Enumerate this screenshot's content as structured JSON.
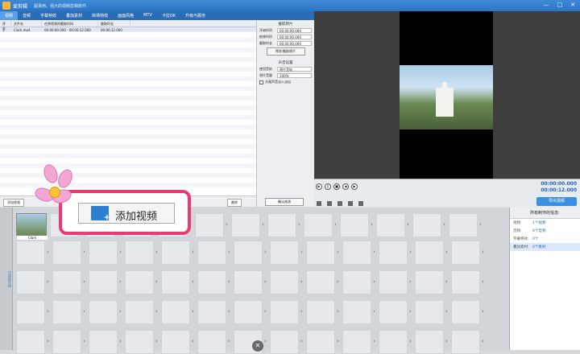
{
  "app": {
    "name": "爱剪辑",
    "slogan": "超易用、强大的视频剪辑软件"
  },
  "tabs": [
    "视频",
    "音频",
    "字幕特效",
    "叠加素材",
    "转场特效",
    "画面风格",
    "MTV",
    "卡拉OK",
    "升级与服务"
  ],
  "table": {
    "headers": [
      "序号",
      "文件名",
      "在原视频的截取时间",
      "截取时长"
    ],
    "rows": [
      {
        "index": "1",
        "name": "Clark.mp4",
        "range": "00:00:00.000 - 00:00:12.000",
        "duration": "00:00:12.000"
      }
    ]
  },
  "side": {
    "cut_title": "截取原片",
    "start_label": "开始时间",
    "start_value": "00:00:00.000",
    "end_label": "结束时间",
    "end_value": "00:00:00.000",
    "duration_label": "截取时长",
    "duration_value": "00:00:00.000",
    "preview_btn": "预览/截取原片",
    "audio_title": "声音设置",
    "track_label": "使用音轨",
    "track_value": "原片音轨",
    "volume_label": "原片音量",
    "volume_value": "100%",
    "fade_label": "头尾声音淡入淡出",
    "confirm_btn": "确认修改"
  },
  "bottom": {
    "add_video": "添加视频",
    "delete": "删除"
  },
  "player": {
    "time_current": "00:00:00.000",
    "time_total": "00:00:12.000",
    "export_btn": "导出视频"
  },
  "timeline": {
    "side_label": "已添加片段",
    "clip_name": "Clark"
  },
  "info": {
    "title": "所有制作的信息:",
    "rows": [
      {
        "k": "视频:",
        "v": "1个视频"
      },
      {
        "k": "音频:",
        "v": "0个音频"
      },
      {
        "k": "字幕特效:",
        "v": "0个"
      },
      {
        "k": "叠加素材:",
        "v": "0个素材"
      }
    ]
  },
  "callout": {
    "text": "添加视频"
  }
}
